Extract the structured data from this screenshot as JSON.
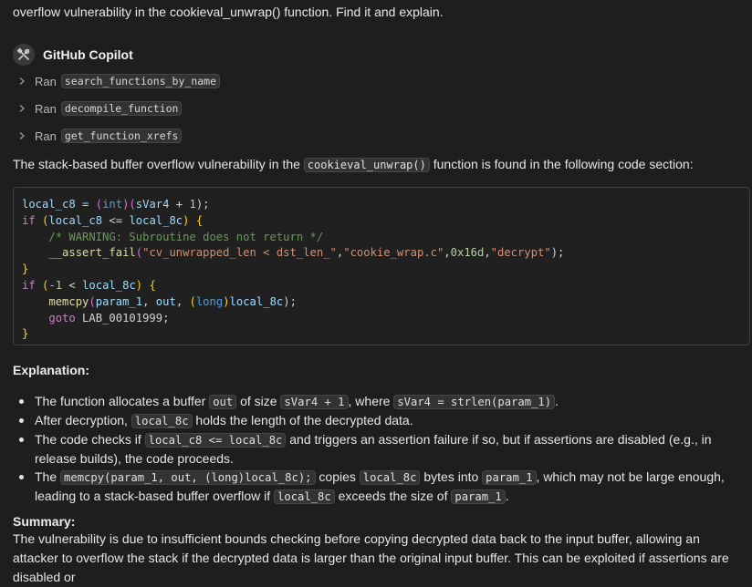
{
  "prompt": {
    "text": "overflow vulnerability in the cookieval_unwrap() function. Find it and explain."
  },
  "agent": {
    "name": "GitHub Copilot",
    "icon": "tools-icon"
  },
  "tool_calls": [
    {
      "prefix": "Ran",
      "tool": "search_functions_by_name"
    },
    {
      "prefix": "Ran",
      "tool": "decompile_function"
    },
    {
      "prefix": "Ran",
      "tool": "get_function_xrefs"
    }
  ],
  "intro": {
    "before": "The stack-based buffer overflow vulnerability in the ",
    "code": "cookieval_unwrap()",
    "after": " function is found in the following code section:"
  },
  "code_block": {
    "l1": {
      "a": "local_c8 = ",
      "b": "(",
      "c": "int",
      "d": ")",
      "e": "(",
      "f": "sVar4",
      "g": " + ",
      "h": "1",
      "i": ");"
    },
    "l2": {
      "a": "if",
      "b": " (",
      "c": "local_c8",
      "d": " <= ",
      "e": "local_8c",
      "f": ") {"
    },
    "l3": {
      "a": "    ",
      "b": "/* WARNING: Subroutine does not return */"
    },
    "l4": {
      "a": "    ",
      "b": "__assert_fail",
      "c": "(",
      "d": "\"cv_unwrapped_len < dst_len_\"",
      "e": ",",
      "f": "\"cookie_wrap.c\"",
      "g": ",",
      "h": "0x16d",
      "i": ",",
      "j": "\"decrypt\"",
      "k": ");"
    },
    "l5": {
      "a": "}"
    },
    "l6": {
      "a": "if",
      "b": " (",
      "c": "-1",
      "d": " < ",
      "e": "local_8c",
      "f": ") {"
    },
    "l7": {
      "a": "    ",
      "b": "memcpy",
      "c": "(",
      "d": "param_1",
      "e": ", ",
      "f": "out",
      "g": ", ",
      "h": "(",
      "i": "long",
      "j": ")",
      "k": "local_8c",
      "l": ");"
    },
    "l8": {
      "a": "    ",
      "b": "goto",
      "c": " LAB_00101999;"
    },
    "l9": {
      "a": "}"
    }
  },
  "explanation": {
    "heading": "Explanation:",
    "bullets": [
      {
        "t1": "The function allocates a buffer ",
        "c1": "out",
        "t2": " of size ",
        "c2": "sVar4 + 1",
        "t3": ", where ",
        "c3": "sVar4 = strlen(param_1)",
        "t4": "."
      },
      {
        "t1": "After decryption, ",
        "c1": "local_8c",
        "t2": " holds the length of the decrypted data."
      },
      {
        "t1": "The code checks if ",
        "c1": "local_c8 <= local_8c",
        "t2": " and triggers an assertion failure if so, but if assertions are disabled (e.g., in release builds), the code proceeds."
      },
      {
        "t1": "The ",
        "c1": "memcpy(param_1, out, (long)local_8c);",
        "t2": " copies ",
        "c2": "local_8c",
        "t3": " bytes into ",
        "c3": "param_1",
        "t4": ", which may not be large enough, leading to a stack-based buffer overflow if ",
        "c4": "local_8c",
        "t5": " exceeds the size of ",
        "c5": "param_1",
        "t6": "."
      }
    ]
  },
  "summary": {
    "heading": "Summary:",
    "text": "The vulnerability is due to insufficient bounds checking before copying decrypted data back to the input buffer, allowing an attacker to overflow the stack if the decrypted data is larger than the original input buffer. This can be exploited if assertions are disabled or"
  }
}
